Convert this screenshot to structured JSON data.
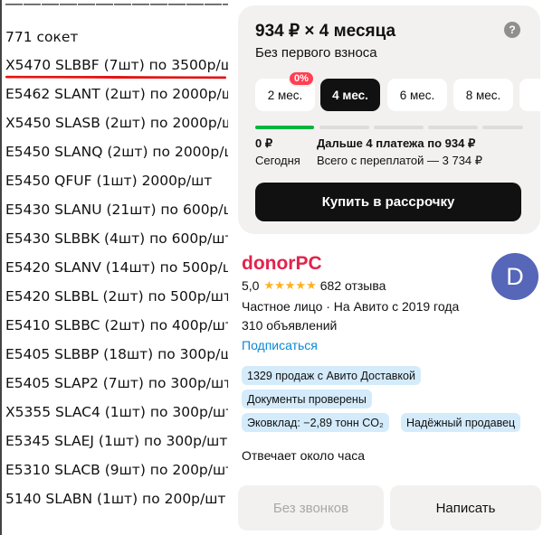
{
  "listing_image": {
    "dashes": "——————————————",
    "lines": [
      "771 сокет",
      "X5470 SLBBF (7шт) по 3500р/шт",
      "E5462 SLANT (2шт) по 2000р/шт",
      "X5450 SLASB (2шт) по 2000р/шт",
      "E5450 SLANQ (2шт) по 2000р/шт",
      "E5450 QFUF (1шт) 2000р/шт",
      "E5430 SLANU (21шт) по 600р/шт",
      "E5430 SLBBK (4шт) по 600р/шт",
      "E5420 SLANV (14шт) по 500р/шт",
      "E5420 SLBBL (2шт) по 500р/шт",
      "E5410 SLBBC (2шт) по 400р/шт",
      "E5405 SLBBP (18шт) по 300р/шт",
      "E5405 SLAP2 (7шт) по 300р/шт",
      "X5355 SLAC4 (1шт) по 300р/шт",
      "E5345 SLAEJ (1шт) по 300р/шт",
      "E5310 SLACB (9шт) по 200р/шт",
      "5140 SLABN (1шт) по 200р/шт"
    ],
    "highlight_color": "#e41414"
  },
  "installment": {
    "title": "934 ₽ × 4 месяца",
    "help_icon": "?",
    "subtitle": "Без первого взноса",
    "badge": "0%",
    "terms": [
      "2 мес.",
      "4 мес.",
      "6 мес.",
      "8 мес."
    ],
    "selected_term": "4 мес.",
    "progress_paid_fraction": 0.2,
    "first_payment_amount": "0 ₽",
    "first_payment_when": "Сегодня",
    "next_payments": "Дальше 4 платежа по 934 ₽",
    "total": "Всего с переплатой — 3 734 ₽",
    "buy_button": "Купить в рассрочку"
  },
  "seller": {
    "name": "donorPC",
    "avatar_letter": "D",
    "rating": "5,0",
    "stars": "★★★★★",
    "reviews": "682 отзыва",
    "type_line": "Частное лицо · На Авито с 2019 года",
    "ads_count": "310 объявлений",
    "subscribe": "Подписаться",
    "chips": [
      "1329 продаж с Авито Доставкой",
      "Документы проверены",
      "Эковклад: −2,89 тонн CO₂",
      "Надёжный продавец"
    ],
    "reply_time": "Отвечает около часа"
  },
  "actions": {
    "no_calls": "Без звонков",
    "write": "Написать"
  },
  "colors": {
    "accent_red": "#e0244c",
    "link_blue": "#0a88d6",
    "progress_green": "#04b53f",
    "avatar_bg": "#5666b8"
  }
}
